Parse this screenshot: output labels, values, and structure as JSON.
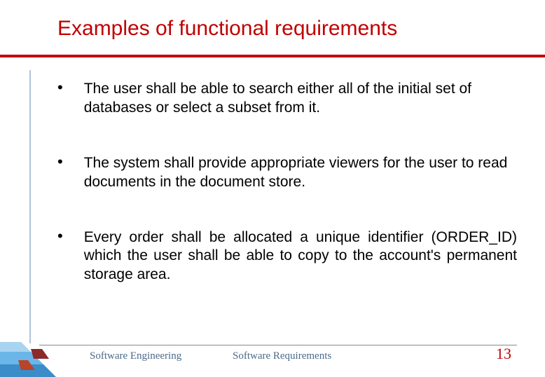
{
  "title": "Examples of functional requirements",
  "bullets": [
    "The user shall be able to search either all of the initial set of databases or select a subset from it.",
    "The system shall provide appropriate viewers for the user to read documents in the document store.",
    "Every order shall be allocated a unique identifier (ORDER_ID) which the user shall be able to copy to the account's permanent storage area."
  ],
  "footer": {
    "left": "Software Engineering",
    "center": "Software Requirements",
    "page": "13"
  }
}
